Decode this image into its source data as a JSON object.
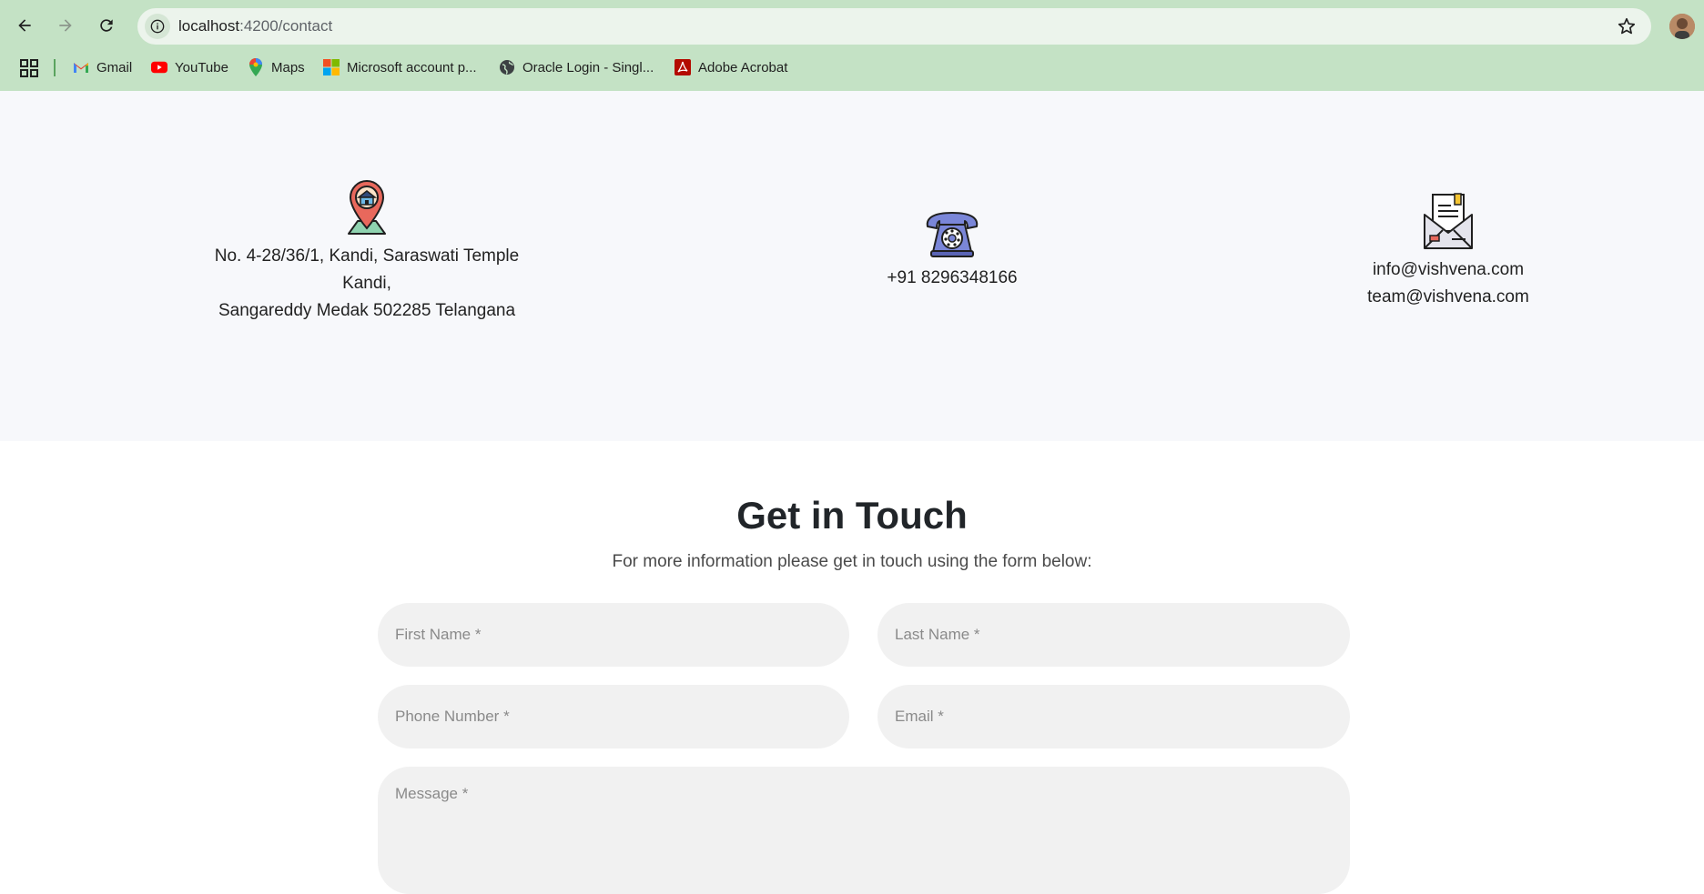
{
  "browser": {
    "url_host": "localhost",
    "url_path": ":4200/contact",
    "bookmarks": [
      {
        "label": "Gmail",
        "icon": "gmail-icon"
      },
      {
        "label": "YouTube",
        "icon": "youtube-icon"
      },
      {
        "label": "Maps",
        "icon": "maps-icon"
      },
      {
        "label": "Microsoft account p...",
        "icon": "microsoft-icon"
      },
      {
        "label": "Oracle Login - Singl...",
        "icon": "globe-icon"
      },
      {
        "label": "Adobe Acrobat",
        "icon": "acrobat-icon"
      }
    ],
    "colors": {
      "chrome_bg": "#c4e2c5",
      "omnibox_bg": "#ecf4ec"
    }
  },
  "contact_info": {
    "address": {
      "line1": "No. 4-28/36/1, Kandi, Saraswati Temple",
      "line2": "Kandi,",
      "line3": "Sangareddy Medak 502285 Telangana",
      "icon": "location-pin-icon"
    },
    "phone": {
      "number": "+91 8296348166",
      "icon": "telephone-icon"
    },
    "email": {
      "primary": "info@vishvena.com",
      "secondary": "team@vishvena.com",
      "icon": "envelope-icon"
    }
  },
  "form": {
    "title": "Get in Touch",
    "subtitle": "For more information please get in touch using the form below:",
    "first_name_placeholder": "First Name *",
    "last_name_placeholder": "Last Name *",
    "phone_placeholder": "Phone Number *",
    "email_placeholder": "Email *",
    "message_placeholder": "Message *"
  }
}
